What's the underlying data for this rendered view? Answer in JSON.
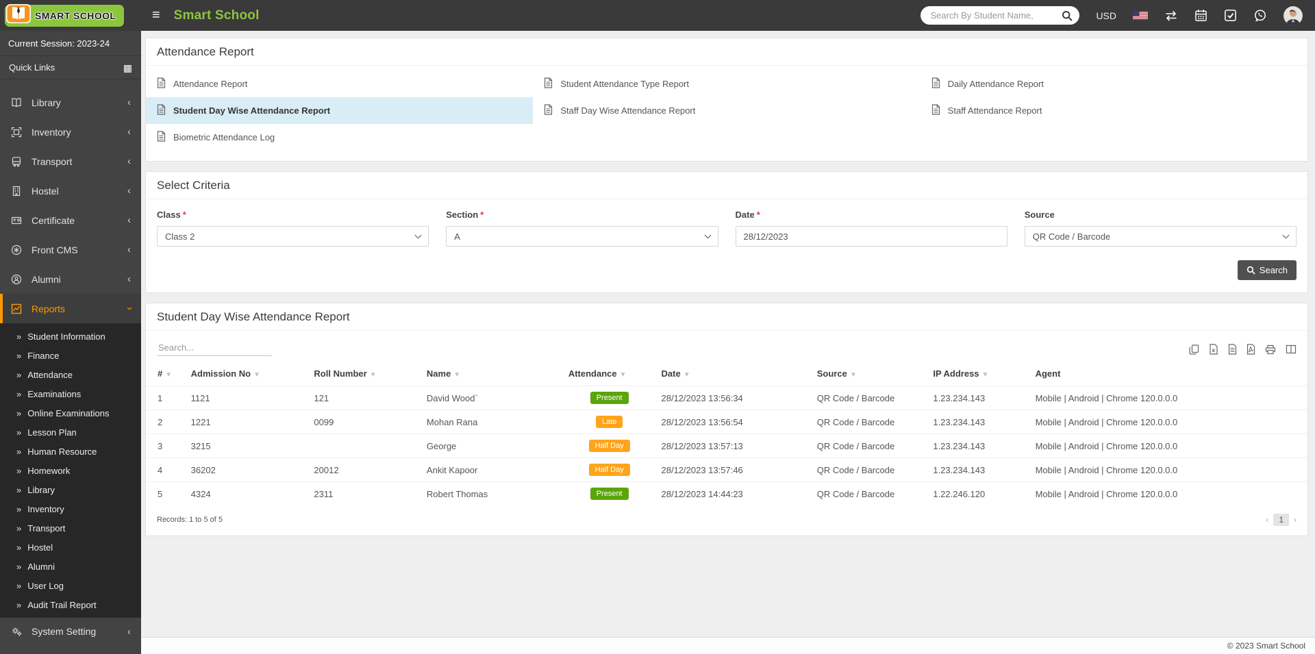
{
  "navbar": {
    "logo_text": "SMART SCHOOL",
    "title": "Smart School",
    "search_placeholder": "Search By Student Name,",
    "currency": "USD"
  },
  "sidebar": {
    "session_label": "Current Session: 2023-24",
    "quick_links_label": "Quick Links",
    "menu": [
      {
        "label": "Library",
        "icon": "book"
      },
      {
        "label": "Inventory",
        "icon": "inventory"
      },
      {
        "label": "Transport",
        "icon": "bus"
      },
      {
        "label": "Hostel",
        "icon": "building"
      },
      {
        "label": "Certificate",
        "icon": "certificate"
      },
      {
        "label": "Front CMS",
        "icon": "frontcms"
      },
      {
        "label": "Alumni",
        "icon": "alumni"
      }
    ],
    "active_item": {
      "label": "Reports",
      "icon": "chart"
    },
    "submenu": [
      "Student Information",
      "Finance",
      "Attendance",
      "Examinations",
      "Online Examinations",
      "Lesson Plan",
      "Human Resource",
      "Homework",
      "Library",
      "Inventory",
      "Transport",
      "Hostel",
      "Alumni",
      "User Log",
      "Audit Trail Report"
    ],
    "bottom_item": {
      "label": "System Setting",
      "icon": "gears"
    }
  },
  "report_links": {
    "title": "Attendance Report",
    "columns": [
      [
        {
          "label": "Attendance Report",
          "active": false
        },
        {
          "label": "Student Day Wise Attendance Report",
          "active": true
        },
        {
          "label": "Biometric Attendance Log",
          "active": false
        }
      ],
      [
        {
          "label": "Student Attendance Type Report",
          "active": false
        },
        {
          "label": "Staff Day Wise Attendance Report",
          "active": false
        }
      ],
      [
        {
          "label": "Daily Attendance Report",
          "active": false
        },
        {
          "label": "Staff Attendance Report",
          "active": false
        }
      ]
    ]
  },
  "criteria": {
    "title": "Select Criteria",
    "fields": [
      {
        "label": "Class",
        "required": true,
        "type": "select",
        "value": "Class 2"
      },
      {
        "label": "Section",
        "required": true,
        "type": "select",
        "value": "A"
      },
      {
        "label": "Date",
        "required": true,
        "type": "text",
        "value": "28/12/2023"
      },
      {
        "label": "Source",
        "required": false,
        "type": "select",
        "value": "QR Code / Barcode"
      }
    ],
    "search_button": "Search"
  },
  "table": {
    "title": "Student Day Wise Attendance Report",
    "search_placeholder": "Search...",
    "export_icons": [
      "copy",
      "excel",
      "csv",
      "pdf",
      "print",
      "columns"
    ],
    "headers": [
      {
        "label": "#",
        "sortable": true
      },
      {
        "label": "Admission No",
        "sortable": true
      },
      {
        "label": "Roll Number",
        "sortable": true
      },
      {
        "label": "Name",
        "sortable": true
      },
      {
        "label": "Attendance",
        "sortable": true
      },
      {
        "label": "Date",
        "sortable": true
      },
      {
        "label": "Source",
        "sortable": true
      },
      {
        "label": "IP Address",
        "sortable": true
      },
      {
        "label": "Agent",
        "sortable": false
      }
    ],
    "rows": [
      {
        "num": "1",
        "admission_no": "1121",
        "roll": "121",
        "name": "David Wood`",
        "attendance": "Present",
        "status": "green",
        "date": "28/12/2023 13:56:34",
        "source": "QR Code / Barcode",
        "ip": "1.23.234.143",
        "agent": "Mobile | Android | Chrome 120.0.0.0"
      },
      {
        "num": "2",
        "admission_no": "1221",
        "roll": "0099",
        "name": "Mohan Rana",
        "attendance": "Late",
        "status": "orange",
        "date": "28/12/2023 13:56:54",
        "source": "QR Code / Barcode",
        "ip": "1.23.234.143",
        "agent": "Mobile | Android | Chrome 120.0.0.0"
      },
      {
        "num": "3",
        "admission_no": "3215",
        "roll": "",
        "name": "George",
        "attendance": "Half Day",
        "status": "orange",
        "date": "28/12/2023 13:57:13",
        "source": "QR Code / Barcode",
        "ip": "1.23.234.143",
        "agent": "Mobile | Android | Chrome 120.0.0.0"
      },
      {
        "num": "4",
        "admission_no": "36202",
        "roll": "20012",
        "name": "Ankit Kapoor",
        "attendance": "Half Day",
        "status": "orange",
        "date": "28/12/2023 13:57:46",
        "source": "QR Code / Barcode",
        "ip": "1.23.234.143",
        "agent": "Mobile | Android | Chrome 120.0.0.0"
      },
      {
        "num": "5",
        "admission_no": "4324",
        "roll": "2311",
        "name": "Robert Thomas",
        "attendance": "Present",
        "status": "green",
        "date": "28/12/2023 14:44:23",
        "source": "QR Code / Barcode",
        "ip": "1.22.246.120",
        "agent": "Mobile | Android | Chrome 120.0.0.0"
      }
    ],
    "records_text": "Records: 1 to 5 of 5",
    "pagination": {
      "prev": "‹",
      "current": "1",
      "next": "›"
    }
  },
  "footer": {
    "copyright": "© 2023 Smart School"
  },
  "colors": {
    "brand_green": "#8cc63e",
    "active_orange": "#ff9801",
    "badge_green": "#5ba40c",
    "badge_orange": "#ffa41c",
    "highlight_blue": "#d9edf7"
  }
}
